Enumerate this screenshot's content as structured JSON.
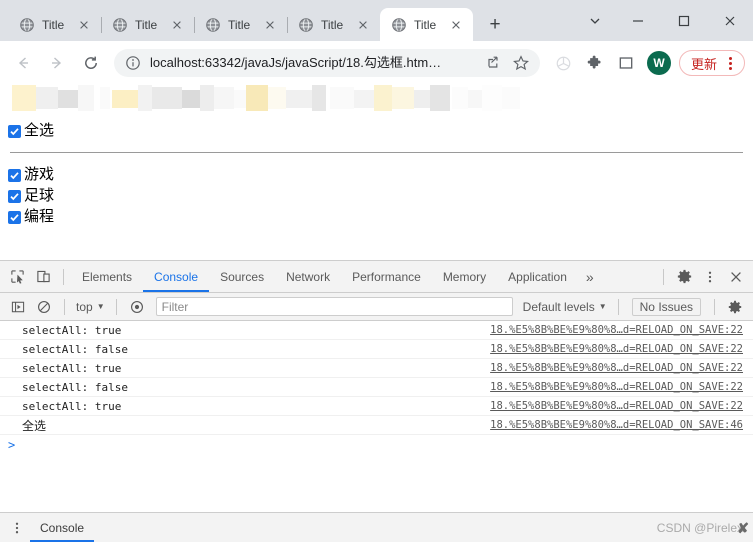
{
  "window": {
    "tab_search_icon": "chevron-down-icon",
    "minimize_icon": "minimize-icon",
    "maximize_icon": "maximize-icon",
    "close_icon": "close-icon"
  },
  "tabs": [
    {
      "title": "Title",
      "favicon": "globe-icon",
      "close": "×",
      "active": false
    },
    {
      "title": "Title",
      "favicon": "globe-icon",
      "close": "×",
      "active": false
    },
    {
      "title": "Title",
      "favicon": "globe-icon",
      "close": "×",
      "active": false
    },
    {
      "title": "Title",
      "favicon": "globe-icon",
      "close": "×",
      "active": false
    },
    {
      "title": "Title",
      "favicon": "globe-icon",
      "close": "×",
      "active": true
    }
  ],
  "new_tab_label": "+",
  "toolbar": {
    "back_icon": "back-arrow-icon",
    "forward_icon": "forward-arrow-icon",
    "reload_icon": "reload-icon",
    "site_info_icon": "info-circle-icon",
    "url": "localhost:63342/javaJs/javaScript/18.勾选框.htm…",
    "share_icon": "share-icon",
    "bookmark_icon": "star-icon",
    "extension_pin_icon": "pinwheel-icon",
    "extensions_icon": "puzzle-piece-icon",
    "sidepanel_icon": "side-panel-icon",
    "avatar_letter": "W",
    "avatar_color": "#0b6b4f",
    "update_label": "更新",
    "update_color": "#c5221f",
    "menu_icon": "kebab-menu-icon"
  },
  "page": {
    "select_all": {
      "label": "全选",
      "checked": true
    },
    "options": [
      {
        "label": "游戏",
        "checked": true
      },
      {
        "label": "足球",
        "checked": true
      },
      {
        "label": "编程",
        "checked": true
      }
    ],
    "checkbox_color": "#1b73e8"
  },
  "devtools": {
    "inspect_icon": "inspect-element-icon",
    "device_icon": "device-toolbar-icon",
    "tabs": [
      {
        "label": "Elements",
        "active": false
      },
      {
        "label": "Console",
        "active": true
      },
      {
        "label": "Sources",
        "active": false
      },
      {
        "label": "Network",
        "active": false
      },
      {
        "label": "Performance",
        "active": false
      },
      {
        "label": "Memory",
        "active": false
      },
      {
        "label": "Application",
        "active": false
      }
    ],
    "more_tabs_label": "»",
    "settings_icon": "gear-icon",
    "kebab_icon": "kebab-menu-icon",
    "close_icon": "close-icon",
    "filterbar": {
      "execute_icon": "execute-snippet-icon",
      "clear_icon": "clear-console-icon",
      "context": "top",
      "context_arrow": "▼",
      "eye_icon": "live-expression-icon",
      "filter_placeholder": "Filter",
      "levels_label": "Default levels",
      "levels_arrow": "▼",
      "issues_label": "No Issues",
      "settings_icon": "gear-icon"
    },
    "log": [
      {
        "message": "selectAll: true",
        "source": "18.%E5%8B%BE%E9%80%8…d=RELOAD_ON_SAVE:22",
        "cjk": false
      },
      {
        "message": "selectAll: false",
        "source": "18.%E5%8B%BE%E9%80%8…d=RELOAD_ON_SAVE:22",
        "cjk": false
      },
      {
        "message": "selectAll: true",
        "source": "18.%E5%8B%BE%E9%80%8…d=RELOAD_ON_SAVE:22",
        "cjk": false
      },
      {
        "message": "selectAll: false",
        "source": "18.%E5%8B%BE%E9%80%8…d=RELOAD_ON_SAVE:22",
        "cjk": false
      },
      {
        "message": "selectAll: true",
        "source": "18.%E5%8B%BE%E9%80%8…d=RELOAD_ON_SAVE:22",
        "cjk": false
      },
      {
        "message": "全选",
        "source": "18.%E5%8B%BE%E9%80%8…d=RELOAD_ON_SAVE:46",
        "cjk": true
      }
    ],
    "prompt": ">",
    "drawer_tab": "Console",
    "drawer_kebab_icon": "kebab-menu-icon"
  },
  "watermark": {
    "text": "CSDN @Pirelex",
    "x": "✘"
  }
}
